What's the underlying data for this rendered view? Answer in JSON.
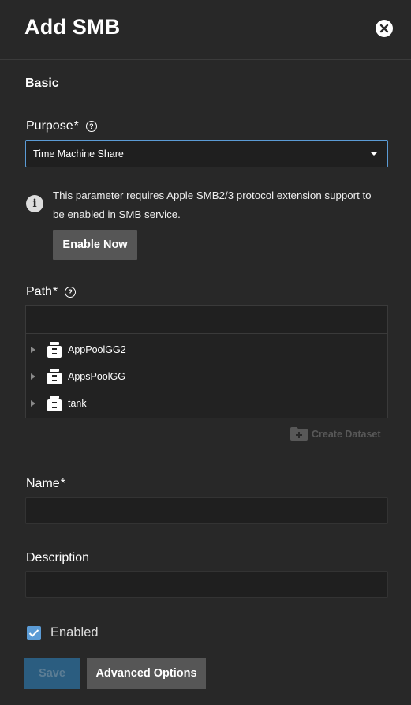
{
  "header": {
    "title": "Add SMB",
    "close_icon": "close-circle-icon"
  },
  "section": {
    "title": "Basic"
  },
  "purpose": {
    "label": "Purpose",
    "required_mark": "*",
    "selected_value": "Time Machine Share",
    "help_icon": "help-circle-icon"
  },
  "notice": {
    "icon": "info-icon",
    "text": "This parameter requires Apple SMB2/3 protocol extension support to be enabled in SMB service.",
    "button_label": "Enable Now"
  },
  "path": {
    "label": "Path",
    "required_mark": "*",
    "value": "",
    "help_icon": "help-circle-icon",
    "nodes": [
      {
        "label": "AppPoolGG2",
        "icon": "pool-icon"
      },
      {
        "label": "AppsPoolGG",
        "icon": "pool-icon"
      },
      {
        "label": "tank",
        "icon": "pool-icon"
      }
    ],
    "create_dataset_label": "Create Dataset"
  },
  "name": {
    "label": "Name",
    "required_mark": "*",
    "value": ""
  },
  "description": {
    "label": "Description",
    "value": ""
  },
  "enabled": {
    "label": "Enabled",
    "checked": true
  },
  "actions": {
    "save_label": "Save",
    "advanced_label": "Advanced Options"
  },
  "colors": {
    "background": "#282828",
    "accent": "#5b9bd5",
    "button_gray": "#565656",
    "save_disabled": "#2b5d80"
  }
}
